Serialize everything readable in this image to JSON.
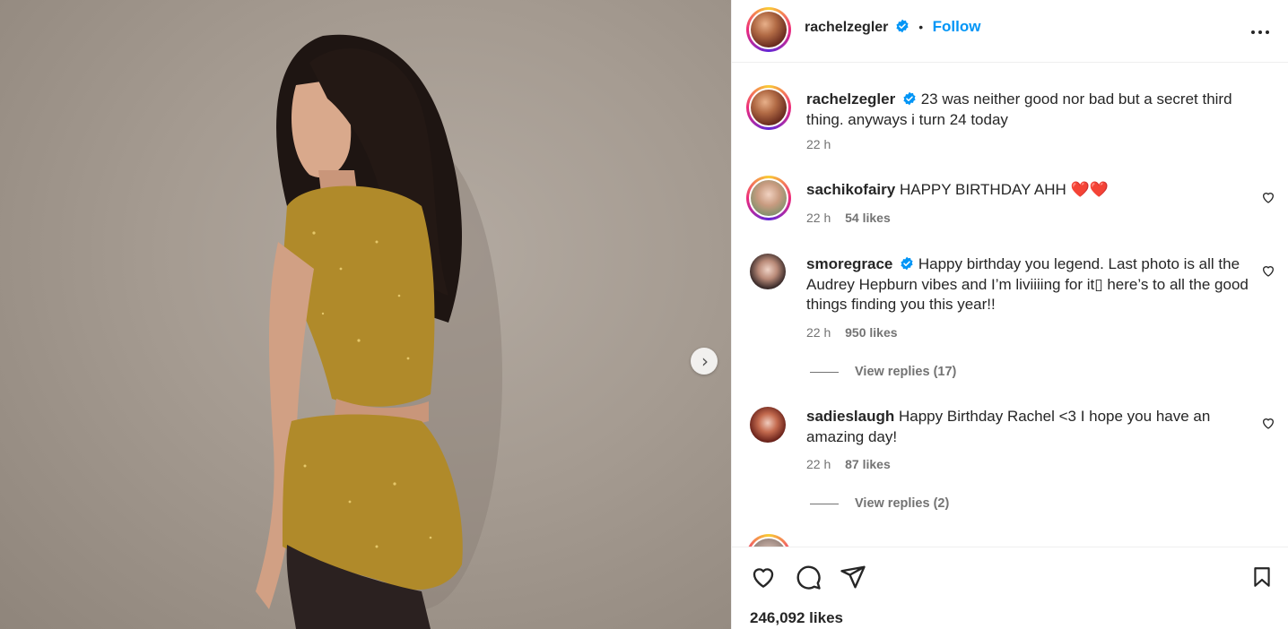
{
  "post": {
    "author": "rachelzegler",
    "follow_label": "Follow",
    "separator": "•",
    "caption": {
      "username": "rachelzegler",
      "text": "23 was neither good nor bad but a secret third thing. anyways i turn 24 today",
      "time": "22 h"
    },
    "likes_text": "246,092 likes"
  },
  "comments": [
    {
      "username": "sachikofairy",
      "verified": false,
      "text": "HAPPY BIRTHDAY AHH ❤️❤️",
      "time": "22 h",
      "likes": "54 likes"
    },
    {
      "username": "smoregrace",
      "verified": true,
      "text": "Happy birthday you legend. Last photo is all the Audrey Hepburn vibes and I’m liviiiing for it▯ here’s to all the good things finding you this year!!",
      "time": "22 h",
      "likes": "950 likes",
      "replies": "View replies (17)"
    },
    {
      "username": "sadieslaugh",
      "verified": false,
      "text": "Happy Birthday Rachel <3 I hope you have an amazing day!",
      "time": "22 h",
      "likes": "87 likes",
      "replies": "View replies (2)"
    }
  ],
  "colors": {
    "accent": "#0095f6",
    "verified": "#0095f6",
    "text": "#262626",
    "muted": "#737373",
    "outfit": "#b08a2a"
  },
  "icons": {
    "like": "heart-icon",
    "comment": "comment-bubble-icon",
    "share": "paper-plane-icon",
    "save": "bookmark-icon",
    "more": "more-horizontal-icon",
    "next": "chevron-right-icon"
  },
  "next_glyph": "›"
}
